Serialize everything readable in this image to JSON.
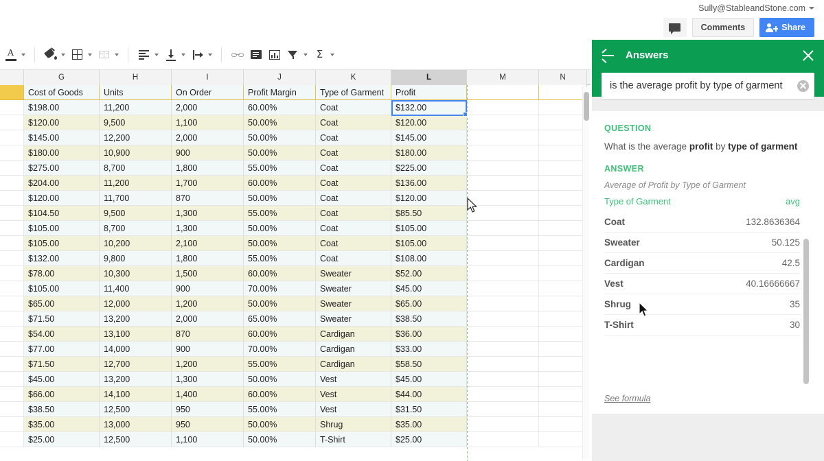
{
  "topbar": {
    "account_email": "Sully@StableandStone.com",
    "comments_label": "Comments",
    "share_label": "Share",
    "share_color": "#4285f4"
  },
  "toolbar": {
    "items": [
      {
        "name": "text-color",
        "has_arrow": true
      },
      {
        "name": "fill-color",
        "has_arrow": true
      },
      {
        "name": "borders",
        "has_arrow": true
      },
      {
        "name": "merge-cells",
        "has_arrow": true
      },
      {
        "name": "horizontal-align",
        "has_arrow": true
      },
      {
        "name": "vertical-align",
        "has_arrow": true
      },
      {
        "name": "text-wrapping",
        "has_arrow": true
      },
      {
        "name": "insert-link",
        "has_arrow": false
      },
      {
        "name": "insert-comment",
        "has_arrow": false
      },
      {
        "name": "insert-chart",
        "has_arrow": false
      },
      {
        "name": "filter",
        "has_arrow": true
      },
      {
        "name": "functions",
        "has_arrow": true
      }
    ]
  },
  "sheet": {
    "column_letters": [
      "G",
      "H",
      "I",
      "J",
      "K",
      "L",
      "M",
      "N"
    ],
    "selected_column": "L",
    "selected_cell_value": "$132.00",
    "header_row_color": "#f2cb4d",
    "headers": [
      "Cost of Goods",
      "Units",
      "On Order",
      "Profit Margin",
      "Type of Garment",
      "Profit"
    ],
    "rows": [
      [
        "$198.00",
        "11,200",
        "2,000",
        "60.00%",
        "Coat",
        "$132.00"
      ],
      [
        "$120.00",
        "9,500",
        "1,100",
        "50.00%",
        "Coat",
        "$120.00"
      ],
      [
        "$145.00",
        "12,200",
        "2,000",
        "50.00%",
        "Coat",
        "$145.00"
      ],
      [
        "$180.00",
        "10,900",
        "900",
        "50.00%",
        "Coat",
        "$180.00"
      ],
      [
        "$275.00",
        "8,700",
        "1,800",
        "55.00%",
        "Coat",
        "$225.00"
      ],
      [
        "$204.00",
        "11,200",
        "1,700",
        "60.00%",
        "Coat",
        "$136.00"
      ],
      [
        "$120.00",
        "11,700",
        "870",
        "50.00%",
        "Coat",
        "$120.00"
      ],
      [
        "$104.50",
        "9,500",
        "1,300",
        "55.00%",
        "Coat",
        "$85.50"
      ],
      [
        "$105.00",
        "8,700",
        "1,300",
        "50.00%",
        "Coat",
        "$105.00"
      ],
      [
        "$105.00",
        "10,200",
        "2,100",
        "50.00%",
        "Coat",
        "$105.00"
      ],
      [
        "$132.00",
        "9,800",
        "1,800",
        "55.00%",
        "Coat",
        "$108.00"
      ],
      [
        "$78.00",
        "10,300",
        "1,500",
        "60.00%",
        "Sweater",
        "$52.00"
      ],
      [
        "$105.00",
        "11,400",
        "900",
        "70.00%",
        "Sweater",
        "$45.00"
      ],
      [
        "$65.00",
        "12,000",
        "1,200",
        "50.00%",
        "Sweater",
        "$65.00"
      ],
      [
        "$71.50",
        "13,200",
        "2,000",
        "65.00%",
        "Sweater",
        "$38.50"
      ],
      [
        "$54.00",
        "13,100",
        "870",
        "60.00%",
        "Cardigan",
        "$36.00"
      ],
      [
        "$77.00",
        "14,000",
        "900",
        "70.00%",
        "Cardigan",
        "$33.00"
      ],
      [
        "$71.50",
        "12,700",
        "1,200",
        "55.00%",
        "Cardigan",
        "$58.50"
      ],
      [
        "$45.00",
        "13,200",
        "1,300",
        "50.00%",
        "Vest",
        "$45.00"
      ],
      [
        "$66.00",
        "14,100",
        "1,400",
        "60.00%",
        "Vest",
        "$44.00"
      ],
      [
        "$38.50",
        "12,500",
        "950",
        "55.00%",
        "Vest",
        "$31.50"
      ],
      [
        "$35.00",
        "13,000",
        "950",
        "50.00%",
        "Shrug",
        "$35.00"
      ],
      [
        "$25.00",
        "12,500",
        "1,100",
        "50.00%",
        "T-Shirt",
        "$25.00"
      ]
    ]
  },
  "panel": {
    "title": "Answers",
    "header_color": "#0b9d52",
    "search_value": "is the average profit by type of garment",
    "question_label": "QUESTION",
    "question_prefix": "What is the average ",
    "question_bold1": "profit",
    "question_mid": " by ",
    "question_bold2": "type of garment",
    "answer_label": "ANSWER",
    "answer_subtitle": "Average of Profit by Type of Garment",
    "see_formula": "See formula",
    "accent_color": "#3ec07a",
    "results": {
      "col_key": "Type of Garment",
      "col_value": "avg",
      "rows": [
        {
          "garment": "Coat",
          "avg": "132.8636364"
        },
        {
          "garment": "Sweater",
          "avg": "50.125"
        },
        {
          "garment": "Cardigan",
          "avg": "42.5"
        },
        {
          "garment": "Vest",
          "avg": "40.16666667"
        },
        {
          "garment": "Shrug",
          "avg": "35"
        },
        {
          "garment": "T-Shirt",
          "avg": "30"
        }
      ]
    }
  }
}
